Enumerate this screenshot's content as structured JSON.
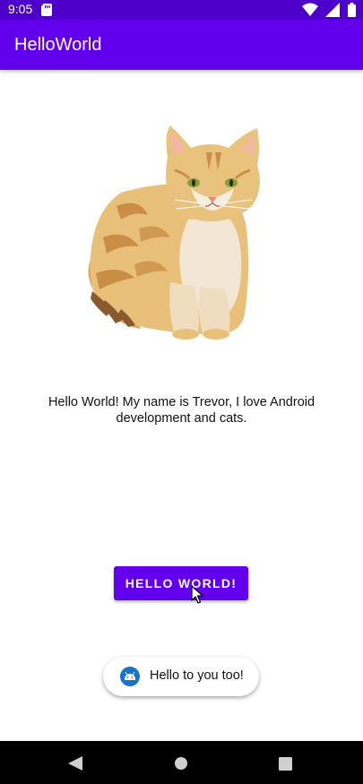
{
  "status_bar": {
    "time": "9:05",
    "icons": [
      "sd-card-icon",
      "wifi-icon",
      "signal-icon",
      "battery-icon"
    ],
    "color": "#4d00c9"
  },
  "app_bar": {
    "title": "HelloWorld",
    "color": "#6200ee"
  },
  "main": {
    "image": "cat-illustration",
    "intro_text": "Hello World! My name is Trevor, I love Android development and cats.",
    "button_label": "HELLO WORLD!"
  },
  "toast": {
    "icon": "android-app-icon",
    "message": "Hello to you too!"
  },
  "nav_bar": {
    "buttons": [
      "back-icon",
      "home-icon",
      "recents-icon"
    ]
  }
}
